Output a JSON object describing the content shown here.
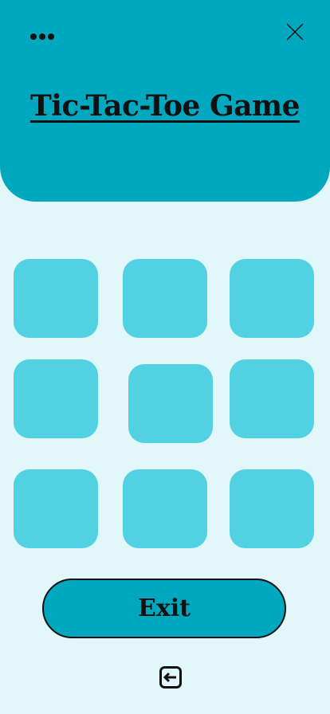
{
  "app": {
    "title": "Tic-Tac-Toe Game"
  },
  "header": {
    "menu_icon": "more-horizontal-icon",
    "close_icon": "close-icon"
  },
  "board": {
    "cells": [
      "",
      "",
      "",
      "",
      "",
      "",
      "",
      "",
      ""
    ]
  },
  "footer": {
    "exit_label": "Exit",
    "exit_icon": "exit-arrow-icon"
  },
  "colors": {
    "header_background": "#00a8bf",
    "page_background": "#e1f7f9",
    "cell_fill": "#52d1e2",
    "exit_button_fill": "#00a8bf",
    "text": "#111111"
  }
}
